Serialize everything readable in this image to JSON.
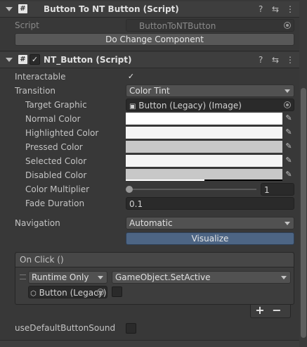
{
  "component1": {
    "title": "Button To NT Button (Script)",
    "script_label": "Script",
    "script_value": "ButtonToNTButton",
    "action_button": "Do Change Component"
  },
  "component2": {
    "title": "NT_Button (Script)",
    "enabled": true,
    "interactable_label": "Interactable",
    "interactable_checked": true,
    "transition_label": "Transition",
    "transition_value": "Color Tint",
    "target_graphic_label": "Target Graphic",
    "target_graphic_value": "Button (Legacy) (Image)",
    "normal_color_label": "Normal Color",
    "highlighted_color_label": "Highlighted Color",
    "pressed_color_label": "Pressed Color",
    "selected_color_label": "Selected Color",
    "disabled_color_label": "Disabled Color",
    "color_multiplier_label": "Color Multiplier",
    "color_multiplier_value": "1",
    "fade_duration_label": "Fade Duration",
    "fade_duration_value": "0.1",
    "navigation_label": "Navigation",
    "navigation_value": "Automatic",
    "visualize_button": "Visualize",
    "onclick_header": "On Click ()",
    "runtime_value": "Runtime Only",
    "function_value": "GameObject.SetActive",
    "object_value": "Button (Legacy)",
    "add_button": "+",
    "remove_button": "−",
    "use_default_sound_label": "useDefaultButtonSound"
  },
  "colors": {
    "normal": "#ffffff",
    "highlighted": "#f5f5f5",
    "pressed": "#c8c8c8",
    "selected": "#f5f5f5",
    "disabled": "#c8c8c8",
    "visualize_bg": "#4d6584"
  },
  "icons": [
    "fold-arrow-icon",
    "script-icon",
    "help-icon",
    "preset-icon",
    "menu-icon",
    "eyedropper-icon",
    "object-picker-icon",
    "image-icon",
    "gameobject-icon"
  ]
}
